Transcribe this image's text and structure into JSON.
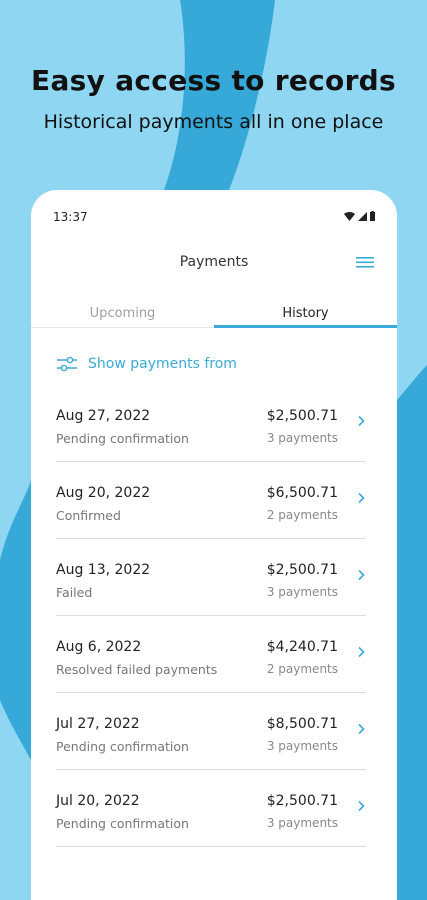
{
  "promo": {
    "headline": "Easy access to records",
    "subhead": "Historical payments all in one place"
  },
  "status_bar": {
    "time": "13:37"
  },
  "app_bar": {
    "title": "Payments",
    "menu_icon": "hamburger-menu-icon"
  },
  "tabs": [
    {
      "label": "Upcoming",
      "active": false
    },
    {
      "label": "History",
      "active": true
    }
  ],
  "filter": {
    "label": "Show payments from",
    "icon": "sliders-icon"
  },
  "payments": [
    {
      "date": "Aug 27, 2022",
      "status": "Pending confirmation",
      "amount": "$2,500.71",
      "count": "3 payments"
    },
    {
      "date": "Aug 20, 2022",
      "status": "Confirmed",
      "amount": "$6,500.71",
      "count": "2 payments"
    },
    {
      "date": "Aug 13, 2022",
      "status": "Failed",
      "amount": "$2,500.71",
      "count": "3 payments"
    },
    {
      "date": "Aug 6, 2022",
      "status": "Resolved failed payments",
      "amount": "$4,240.71",
      "count": "2 payments"
    },
    {
      "date": "Jul 27, 2022",
      "status": "Pending confirmation",
      "amount": "$8,500.71",
      "count": "3 payments"
    },
    {
      "date": "Jul 20, 2022",
      "status": "Pending confirmation",
      "amount": "$2,500.71",
      "count": "3 payments"
    }
  ],
  "colors": {
    "background": "#8ed6f2",
    "background_stroke": "#36a9d9",
    "accent": "#3aaad6"
  }
}
